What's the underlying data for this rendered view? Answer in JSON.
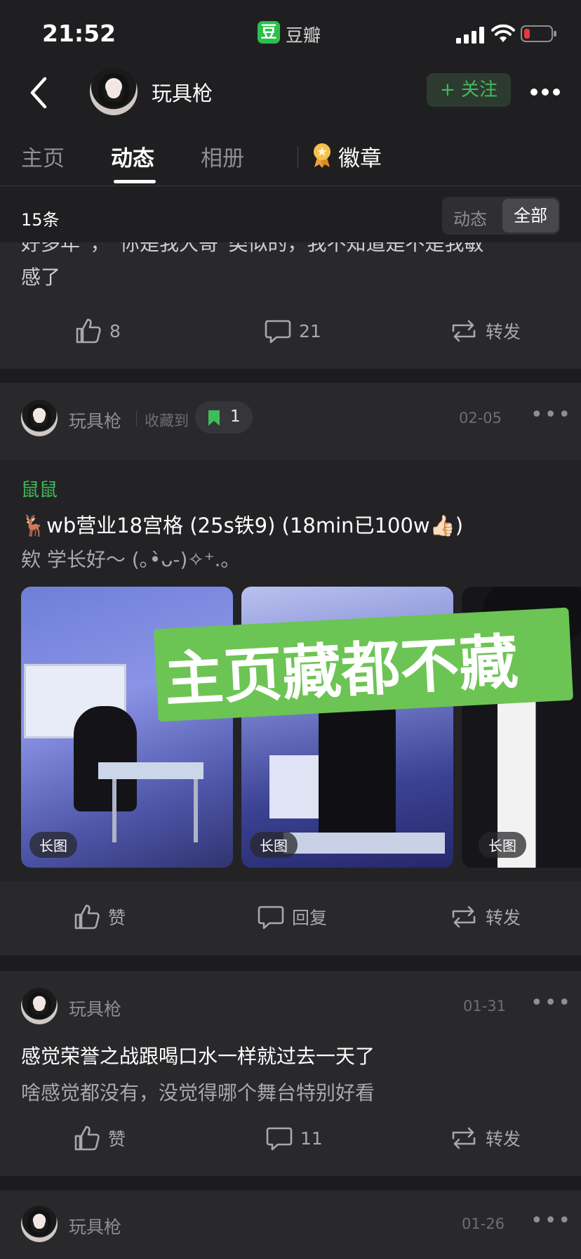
{
  "status_bar": {
    "time": "21:52",
    "app_badge_glyph": "豆",
    "app_name": "豆瓣"
  },
  "header": {
    "username": "玩具枪",
    "follow_label": "+ 关注"
  },
  "tabs": [
    {
      "label": "主页",
      "active": false
    },
    {
      "label": "动态",
      "active": true
    },
    {
      "label": "相册",
      "active": false
    },
    {
      "label": "徽章",
      "active": false
    }
  ],
  "filter": {
    "count": "15条",
    "options": [
      "动态",
      "全部"
    ],
    "selected": "全部"
  },
  "post0": {
    "partial_text_line1": "好多年”，“你是我大哥”类似的，我不知道是不是我敏",
    "partial_text_line2": "感了",
    "likes": "8",
    "comments": "21",
    "repost": "转发"
  },
  "post1": {
    "author": "玩具枪",
    "collected_label": "收藏到",
    "collect_count": "1",
    "date": "02-05",
    "group": "鼠鼠",
    "title": "🦌wb营业18宫格 (25s铁9) (18min已100w👍🏻)",
    "body": "欸  学长好～ (｡•̀ᴗ-)✧⁺.｡",
    "overlay_text": "主页藏都不藏",
    "image_tags": [
      "长图",
      "长图",
      "长图"
    ],
    "like_label": "赞",
    "reply_label": "回复",
    "repost_label": "转发"
  },
  "post2": {
    "author": "玩具枪",
    "date": "01-31",
    "title": "感觉荣誉之战跟喝口水一样就过去一天了",
    "body": "啥感觉都没有，没觉得哪个舞台特别好看",
    "like_label": "赞",
    "comments": "11",
    "repost_label": "转发"
  },
  "post3": {
    "author": "玩具枪",
    "date": "01-26"
  },
  "colors": {
    "accent_green": "#3fbd5a",
    "overlay_green": "#6cc454",
    "bg": "#1f1f21",
    "card": "#29292c"
  },
  "icons": [
    "back-arrow-icon",
    "signal-icon",
    "wifi-icon",
    "battery-low-icon",
    "more-icon",
    "medal-icon",
    "thumb-up-icon",
    "comment-icon",
    "repost-icon",
    "bookmark-icon"
  ]
}
